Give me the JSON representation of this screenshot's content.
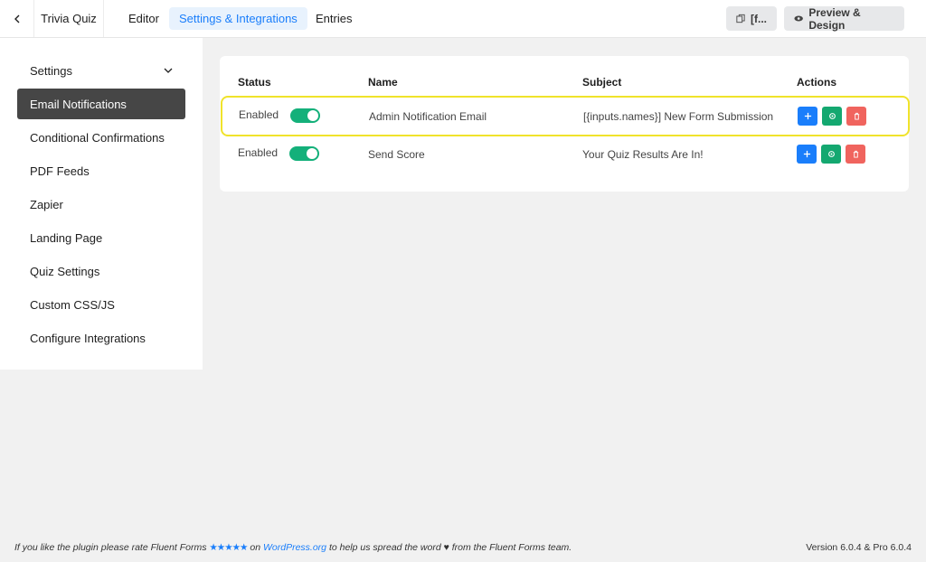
{
  "topbar": {
    "form_title": "Trivia Quiz",
    "tabs": [
      {
        "label": "Editor",
        "active": false
      },
      {
        "label": "Settings & Integrations",
        "active": true
      },
      {
        "label": "Entries",
        "active": false
      }
    ],
    "shortcode_button_label": "[f...",
    "preview_button_label": "Preview & Design"
  },
  "sidebar": {
    "items": [
      {
        "label": "Settings",
        "active": false,
        "has_chevron": true
      },
      {
        "label": "Email Notifications",
        "active": true
      },
      {
        "label": "Conditional Confirmations",
        "active": false
      },
      {
        "label": "PDF Feeds",
        "active": false
      },
      {
        "label": "Zapier",
        "active": false
      },
      {
        "label": "Landing Page",
        "active": false
      },
      {
        "label": "Quiz Settings",
        "active": false
      },
      {
        "label": "Custom CSS/JS",
        "active": false
      },
      {
        "label": "Configure Integrations",
        "active": false
      }
    ]
  },
  "table": {
    "headers": {
      "status": "Status",
      "name": "Name",
      "subject": "Subject",
      "actions": "Actions"
    },
    "rows": [
      {
        "status": "Enabled",
        "enabled": true,
        "name": "Admin Notification Email",
        "subject": "[{inputs.names}] New Form Submission",
        "highlighted": true
      },
      {
        "status": "Enabled",
        "enabled": true,
        "name": "Send Score",
        "subject": "Your Quiz Results Are In!",
        "highlighted": false
      }
    ],
    "action_icons": [
      "plus-icon",
      "gear-icon",
      "trash-icon"
    ]
  },
  "footer": {
    "left_prefix": "If you like the plugin please rate Fluent Forms",
    "stars": "★★★★★",
    "left_on": "on",
    "link_text": "WordPress.org",
    "left_suffix": "to help us spread the word ♥ from the Fluent Forms team.",
    "version": "Version 6.0.4 & Pro 6.0.4"
  },
  "colors": {
    "accent": "#1a7efb",
    "toggle_on": "#14b07a",
    "sidebar_active": "#464646",
    "highlight_outline": "#f0e32b",
    "action_add": "#1a7efb",
    "action_settings": "#14a870",
    "action_delete": "#f0645e"
  }
}
